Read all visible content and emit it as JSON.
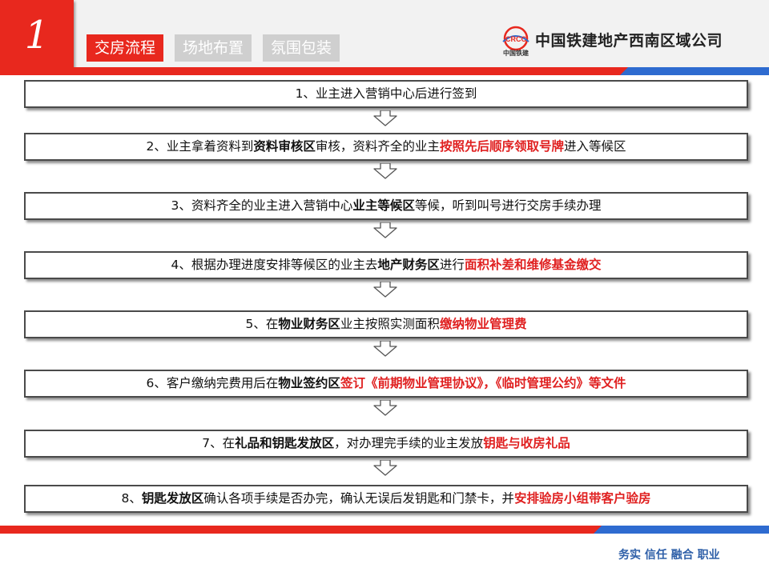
{
  "header": {
    "slide_number": "1",
    "tabs": [
      {
        "label": "交房流程",
        "active": true
      },
      {
        "label": "场地布置",
        "active": false
      },
      {
        "label": "氛围包装",
        "active": false
      }
    ],
    "logo_text": "CRCC",
    "logo_subtitle": "中国铁建",
    "company": "中国铁建地产西南区域公司"
  },
  "steps": [
    {
      "parts": [
        {
          "t": "1、业主进入营销中心后进行签到",
          "s": ""
        }
      ]
    },
    {
      "parts": [
        {
          "t": "2、业主拿着资料到",
          "s": ""
        },
        {
          "t": "资料审核区",
          "s": "b"
        },
        {
          "t": "审核，资料齐全的业主",
          "s": ""
        },
        {
          "t": "按照先后顺序领取号牌",
          "s": "r"
        },
        {
          "t": "进入等候区",
          "s": ""
        }
      ]
    },
    {
      "parts": [
        {
          "t": "3、资料齐全的业主进入营销中心",
          "s": ""
        },
        {
          "t": "业主等候区",
          "s": "b"
        },
        {
          "t": "等候，听到叫号进行交房手续办理",
          "s": ""
        }
      ]
    },
    {
      "parts": [
        {
          "t": "4、根据办理进度安排等候区的业主去",
          "s": ""
        },
        {
          "t": "地产财务区",
          "s": "b"
        },
        {
          "t": "进行",
          "s": ""
        },
        {
          "t": "面积补差和维修基金缴交",
          "s": "r"
        }
      ]
    },
    {
      "parts": [
        {
          "t": "5、在",
          "s": ""
        },
        {
          "t": "物业财务区",
          "s": "b"
        },
        {
          "t": "业主按照实测面积",
          "s": ""
        },
        {
          "t": "缴纳物业管理费",
          "s": "r"
        }
      ]
    },
    {
      "parts": [
        {
          "t": "6、客户缴纳完费用后在",
          "s": ""
        },
        {
          "t": "物业签约区",
          "s": "b"
        },
        {
          "t": "签订《前期物业管理协议》，《临时管理公约》等文件",
          "s": "r"
        }
      ]
    },
    {
      "parts": [
        {
          "t": "7、在",
          "s": ""
        },
        {
          "t": "礼品和钥匙发放区",
          "s": "b"
        },
        {
          "t": "，对办理完手续的业主发放",
          "s": ""
        },
        {
          "t": "钥匙与收房礼品",
          "s": "r"
        }
      ]
    },
    {
      "parts": [
        {
          "t": "8、",
          "s": ""
        },
        {
          "t": "钥匙发放区",
          "s": "b"
        },
        {
          "t": "确认各项手续是否办完，确认无误后发钥匙和门禁卡，并",
          "s": ""
        },
        {
          "t": "安排验房小组带客户验房",
          "s": "r"
        }
      ]
    }
  ],
  "footer": {
    "motto": "务实  信任  融合  职业"
  },
  "colors": {
    "accent_red": "#e8281e",
    "accent_blue": "#2e6bd0",
    "highlight_red": "#e02020",
    "motto_blue": "#2e5fa8"
  }
}
